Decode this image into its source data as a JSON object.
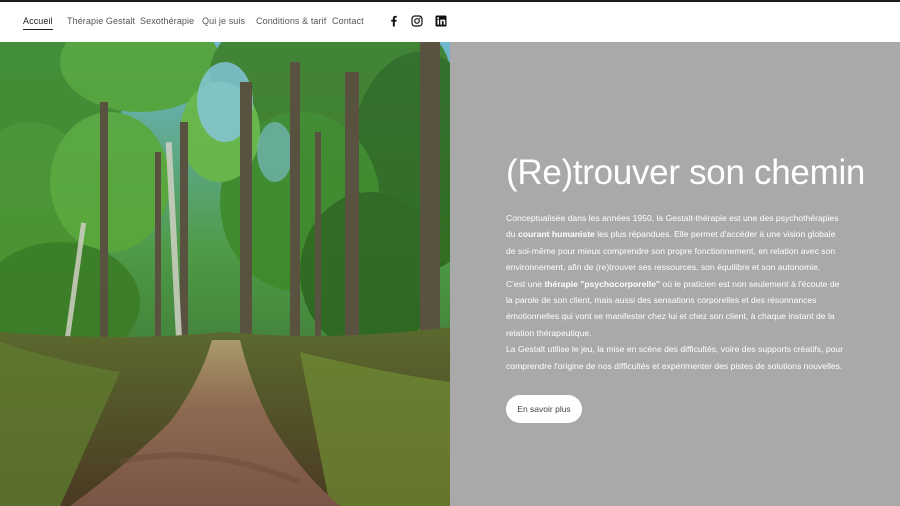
{
  "nav": {
    "items": [
      {
        "label": "Accueil",
        "active": true
      },
      {
        "label": "Thérapie Gestalt"
      },
      {
        "label": "Sexothérapie"
      },
      {
        "label": "Qui je suis"
      },
      {
        "label": "Conditions & tarif"
      },
      {
        "label": "Contact"
      }
    ],
    "social": [
      "facebook-icon",
      "instagram-icon",
      "linkedin-icon"
    ]
  },
  "hero": {
    "title": "(Re)trouver son chemin",
    "p1_a": "Conceptualisée dans les années 1950, la Gestalt-thérapie est une des psychothérapies du ",
    "p1_bold": "courant humaniste",
    "p1_b": " les plus répandues. Elle permet d'accéder à une vision globale de soi-même pour mieux comprendre son propre fonctionnement, en relation avec son environnement, afin de (re)trouver ses ressources, son équilibre et son autonomie.",
    "p2_a": "C'est une ",
    "p2_bold": "thérapie \"psychocorporelle\"",
    "p2_b": " où le praticien est non seulement à l'écoute de la parole de son client, mais aussi des sensations corporelles et des résonnances émotionnelles qui vont se manifester chez lui et chez son client, à chaque instant de la relation thérapeutique.",
    "p3": "La Gestalt  utilise le jeu, la mise en scène des difficultés, voire des supports créatifs, pour comprendre l'origine de nos difficultés et expérimenter des pistes de solutions nouvelles.",
    "cta": "En savoir plus"
  },
  "colors": {
    "panel": "#a9a9a9",
    "header": "#ffffff",
    "text_on_panel": "#ffffff"
  }
}
